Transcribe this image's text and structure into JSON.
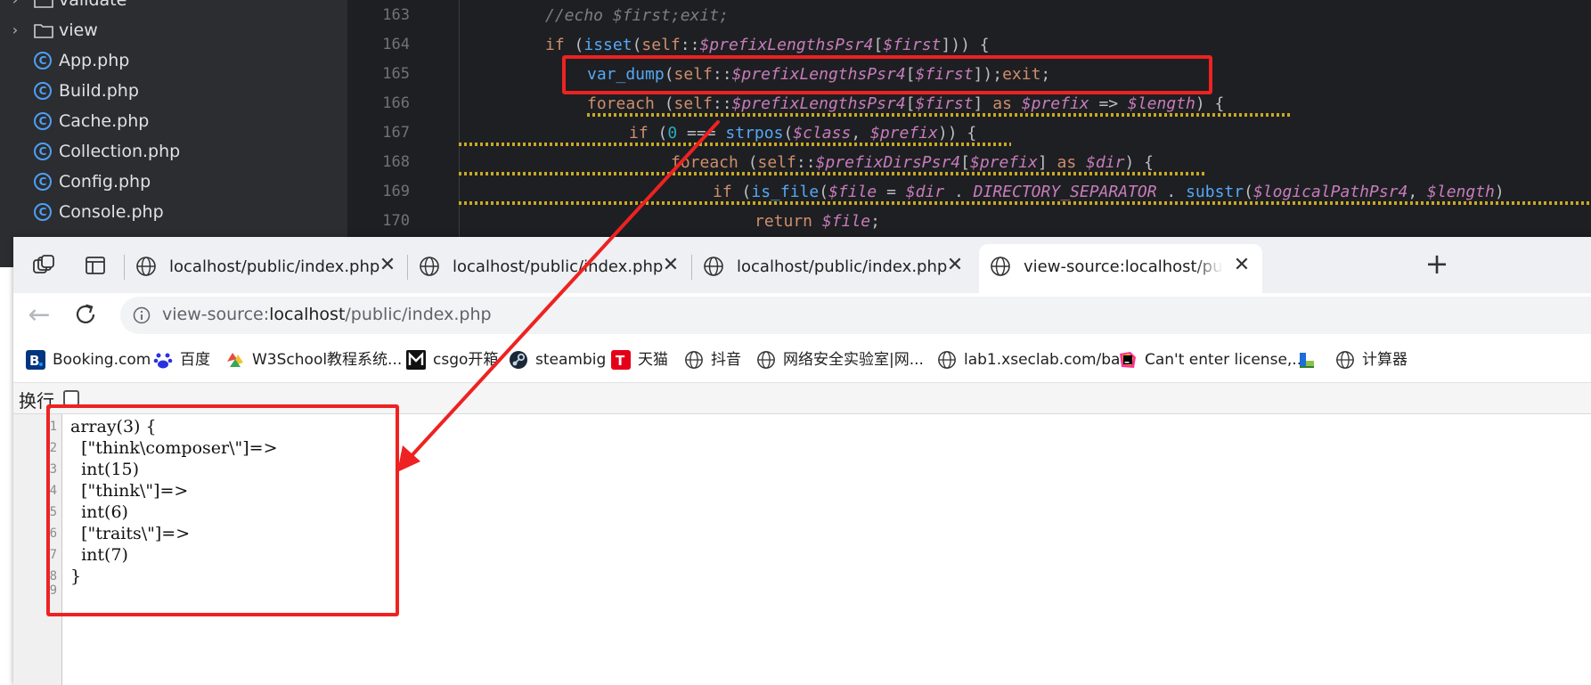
{
  "ide": {
    "tree": [
      {
        "type": "folder",
        "label": "validate",
        "chevron": "›"
      },
      {
        "type": "folder",
        "label": "view",
        "chevron": "›"
      },
      {
        "type": "class",
        "label": "App.php"
      },
      {
        "type": "class",
        "label": "Build.php"
      },
      {
        "type": "class",
        "label": "Cache.php"
      },
      {
        "type": "class",
        "label": "Collection.php"
      },
      {
        "type": "class",
        "label": "Config.php"
      },
      {
        "type": "class",
        "label": "Console.php"
      }
    ],
    "code": [
      {
        "ln": "163",
        "text": "//echo $first;exit;"
      },
      {
        "ln": "164",
        "text": "if (isset(self::$prefixLengthsPsr4[$first])) {"
      },
      {
        "ln": "165",
        "text": "var_dump(self::$prefixLengthsPsr4[$first]);exit;"
      },
      {
        "ln": "166",
        "text": "foreach (self::$prefixLengthsPsr4[$first] as $prefix => $length) {"
      },
      {
        "ln": "167",
        "text": "if (0 === strpos($class, $prefix)) {"
      },
      {
        "ln": "168",
        "text": "foreach (self::$prefixDirsPsr4[$prefix] as $dir) {"
      },
      {
        "ln": "169",
        "text": "if (is_file($file = $dir . DIRECTORY_SEPARATOR . substr($logicalPathPsr4, $length)"
      },
      {
        "ln": "170",
        "text": "return $file;"
      }
    ]
  },
  "browser": {
    "tabs": [
      {
        "label": "localhost/public/index.php",
        "close": "✕"
      },
      {
        "label": "localhost/public/index.php",
        "close": "✕"
      },
      {
        "label": "localhost/public/index.php",
        "close": "✕"
      },
      {
        "label": "view-source:localhost/public/index.php",
        "close": "✕",
        "active": true
      }
    ],
    "new_tab": "+",
    "address": {
      "prefix": "view-source:",
      "host": "localhost",
      "path": "/public/index.php"
    },
    "bookmarks": [
      {
        "label": "Booking.com",
        "icon": "booking-icon"
      },
      {
        "label": "百度",
        "icon": "baidu-icon"
      },
      {
        "label": "W3School教程系统...",
        "icon": "w3school-icon"
      },
      {
        "label": "csgo开箱",
        "icon": "csgo-icon"
      },
      {
        "label": "steambig",
        "icon": "steam-icon"
      },
      {
        "label": "天猫",
        "icon": "tmall-icon"
      },
      {
        "label": "抖音",
        "icon": "globe-icon"
      },
      {
        "label": "网络安全实验室|网...",
        "icon": "globe-icon"
      },
      {
        "label": "lab1.xseclab.com/ba...",
        "icon": "globe-icon"
      },
      {
        "label": "Can't enter license,...",
        "icon": "jetbrains-icon"
      },
      {
        "label": "",
        "icon": "app-icon"
      },
      {
        "label": "计算器",
        "icon": "globe-icon"
      }
    ],
    "wrap_label": "换行",
    "source_lines": [
      {
        "ln": "1",
        "text": "array(3) {"
      },
      {
        "ln": "2",
        "text": "  [\"think\\composer\\\"]=>"
      },
      {
        "ln": "3",
        "text": "  int(15)"
      },
      {
        "ln": "4",
        "text": "  [\"think\\\"]=>"
      },
      {
        "ln": "5",
        "text": "  int(6)"
      },
      {
        "ln": "6",
        "text": "  [\"traits\\\"]=>"
      },
      {
        "ln": "7",
        "text": "  int(7)"
      },
      {
        "ln": "8",
        "text": "}"
      },
      {
        "ln": "9",
        "text": ""
      }
    ]
  },
  "colors": {
    "annotation": "#ee2222",
    "ide_bg": "#1e1f22",
    "keyword": "#cf8e6d",
    "variable": "#c77dbb",
    "function": "#56a8f5"
  }
}
